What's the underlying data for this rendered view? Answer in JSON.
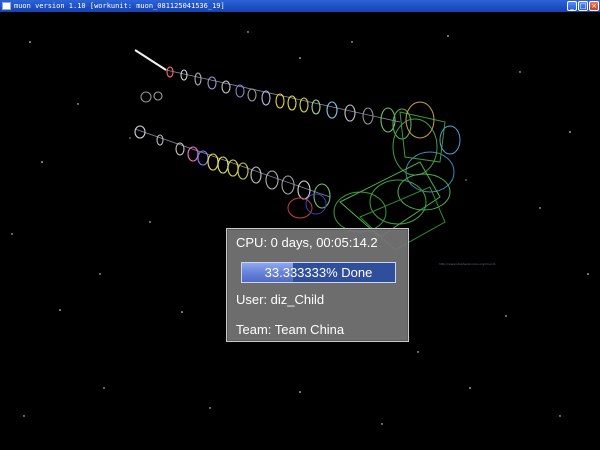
{
  "window": {
    "title": "muon version 1.10 [workunit: muon_081125041536_19]",
    "buttons": {
      "minimize": "_",
      "maximize": "□",
      "close": "×"
    }
  },
  "panel": {
    "cpu_text": "CPU: 0 days, 00:05:14.2",
    "progress_label": "33.333333% Done",
    "progress_fraction": 0.3333,
    "user_text": "User:  diz_Child",
    "team_text": "Team: Team China"
  },
  "scene": {
    "caption": "http://www.stephenbrooks.org/muon1"
  },
  "colors": {
    "background": "#000000",
    "titlebar": "#1c4fc4",
    "progress_bar": "#2f4e9c",
    "progress_fill": "#6b86dc"
  }
}
